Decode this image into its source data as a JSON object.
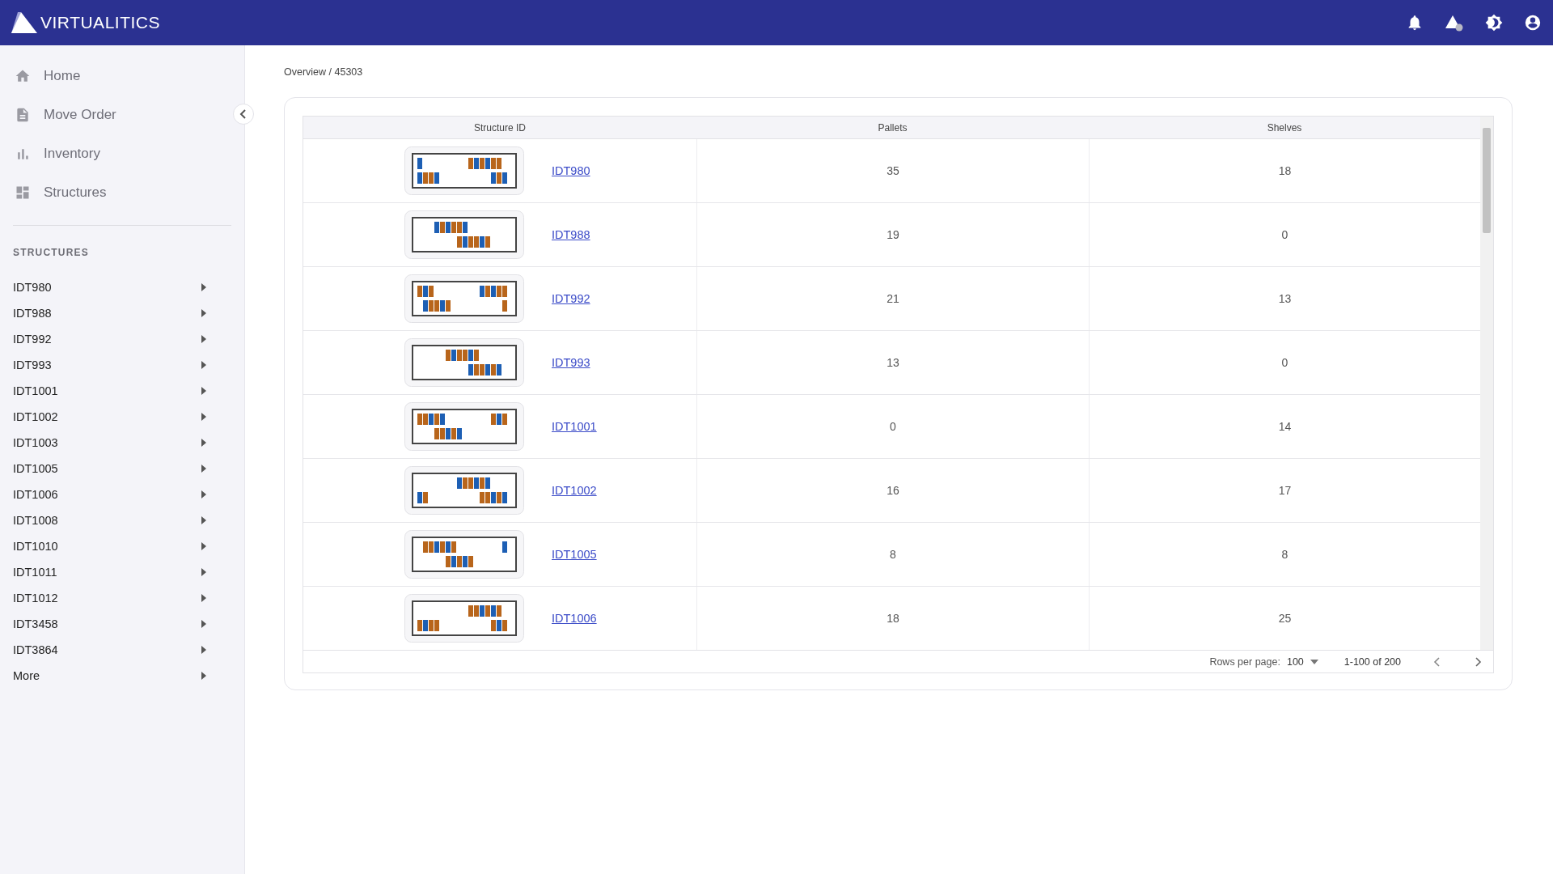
{
  "app": {
    "logo_text": "VIRTUALITICS"
  },
  "nav": [
    {
      "label": "Home",
      "selected": false
    },
    {
      "label": "Move Order",
      "selected": false
    },
    {
      "label": "Inventory",
      "selected": false
    },
    {
      "label": "Structures",
      "selected": false
    }
  ],
  "structures_heading": "STRUCTURES",
  "structures": [
    {
      "label": "IDT980",
      "expanded": false
    },
    {
      "label": "IDT988",
      "expanded": false
    },
    {
      "label": "IDT992",
      "expanded": false
    },
    {
      "label": "IDT993",
      "expanded": false
    },
    {
      "label": "IDT1001",
      "expanded": false
    },
    {
      "label": "IDT1002",
      "expanded": false
    },
    {
      "label": "IDT1003",
      "expanded": false
    },
    {
      "label": "IDT1005",
      "expanded": false
    },
    {
      "label": "IDT1006",
      "expanded": false
    },
    {
      "label": "IDT1008",
      "expanded": false
    },
    {
      "label": "IDT1010",
      "expanded": false
    },
    {
      "label": "IDT1011",
      "expanded": false
    },
    {
      "label": "IDT1012",
      "expanded": false
    },
    {
      "label": "IDT3458",
      "expanded": false
    },
    {
      "label": "IDT3864",
      "expanded": false
    },
    {
      "label": "More",
      "expanded": false
    }
  ],
  "breadcrumb": "Overview / 45303",
  "table": {
    "columns": [
      "Structure ID",
      "Pallets",
      "Shelves"
    ],
    "rows": [
      {
        "id": "IDT980",
        "pallets": "35",
        "shelves": "18"
      },
      {
        "id": "IDT988",
        "pallets": "19",
        "shelves": "0"
      },
      {
        "id": "IDT992",
        "pallets": "21",
        "shelves": "13"
      },
      {
        "id": "IDT993",
        "pallets": "13",
        "shelves": "0"
      },
      {
        "id": "IDT1001",
        "pallets": "0",
        "shelves": "14"
      },
      {
        "id": "IDT1002",
        "pallets": "16",
        "shelves": "17"
      },
      {
        "id": "IDT1005",
        "pallets": "8",
        "shelves": "8"
      },
      {
        "id": "IDT1006",
        "pallets": "18",
        "shelves": "25"
      }
    ]
  },
  "pagination": {
    "rows_per_page_label": "Rows per page:",
    "rows_per_page": "100",
    "range": "1-100 of 200"
  }
}
